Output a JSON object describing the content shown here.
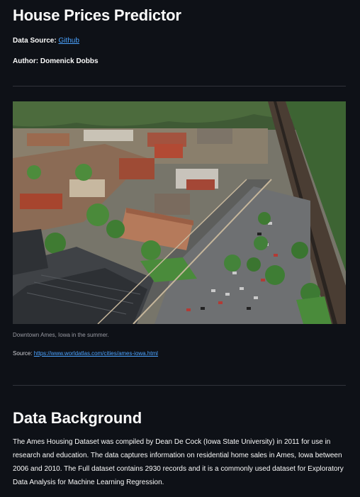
{
  "header": {
    "title": "House Prices Predictor",
    "source_label": "Data Source: ",
    "source_link": "Github",
    "author": "Author: Domenick Dobbs"
  },
  "image": {
    "description": "Aerial photo of downtown Ames, Iowa",
    "caption": "Downtown Ames, Iowa in the summer.",
    "source_label": "Source: ",
    "source_url": "https://www.worldatlas.com/cities/ames-iowa.html"
  },
  "background": {
    "title": "Data Background",
    "paragraph": "The Ames Housing Dataset was compiled by Dean De Cock (Iowa State University) in 2011 for use in research and education. The data captures information on residential home sales in Ames, Iowa between 2006 and 2010. The Full dataset contains 2930 records and it is a commonly used dataset for Exploratory Data Analysis for Machine Learning Regression."
  },
  "colors": {
    "background": "#0e1117",
    "link": "#4ba3ff",
    "divider": "#31333b"
  }
}
